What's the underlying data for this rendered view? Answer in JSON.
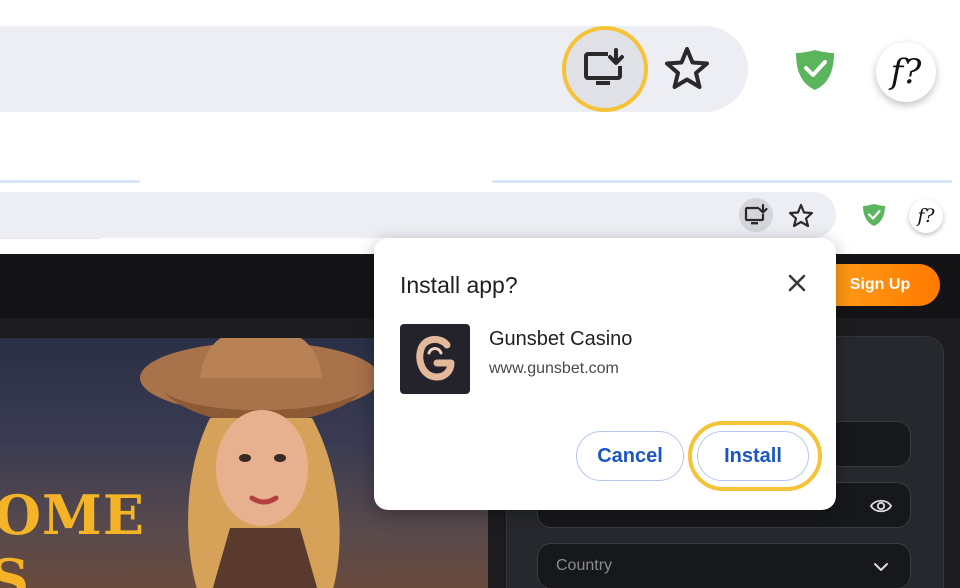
{
  "zoom_toolbar": {
    "install_icon": "install-app-icon",
    "bookmark_icon": "star-icon",
    "extension_shield_icon": "adguard-shield-icon",
    "extension_f_label": "f?"
  },
  "toolbar": {
    "install_icon": "install-app-icon",
    "bookmark_icon": "star-icon",
    "extension_shield_icon": "adguard-shield-icon",
    "extension_f_label": "f?"
  },
  "site": {
    "signup_label": "Sign Up",
    "hero_line1": "OME",
    "hero_line2": "S",
    "form": {
      "password_placeholder": "",
      "country_label": "Country"
    }
  },
  "dialog": {
    "title": "Install app?",
    "app_name": "Gunsbet Casino",
    "app_url": "www.gunsbet.com",
    "cancel_label": "Cancel",
    "install_label": "Install"
  },
  "colors": {
    "highlight": "#f6c237",
    "button_text": "#1b57c4",
    "signup_orange": "#ff8a0d",
    "hero_text": "#f5b427",
    "shield_green": "#5bb55d"
  }
}
